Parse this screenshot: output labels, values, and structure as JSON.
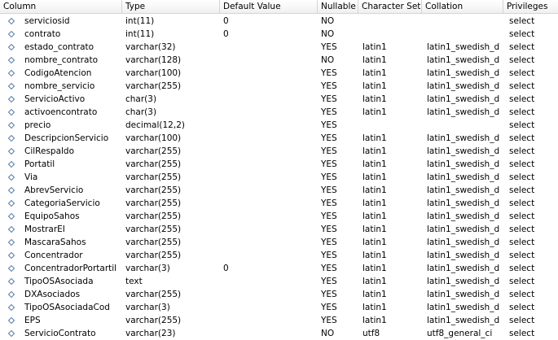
{
  "headers": [
    "Column",
    "Type",
    "Default Value",
    "Nullable",
    "Character Set",
    "Collation",
    "Privileges"
  ],
  "column_icon": "diamond-column-icon",
  "rows": [
    [
      "serviciosid",
      "int(11)",
      "0",
      "NO",
      "",
      "",
      "select"
    ],
    [
      "contrato",
      "int(11)",
      "0",
      "NO",
      "",
      "",
      "select"
    ],
    [
      "estado_contrato",
      "varchar(32)",
      "",
      "YES",
      "latin1",
      "latin1_swedish_d",
      "select"
    ],
    [
      "nombre_contrato",
      "varchar(128)",
      "",
      "NO",
      "latin1",
      "latin1_swedish_d",
      "select"
    ],
    [
      "CodigoAtencion",
      "varchar(100)",
      "",
      "YES",
      "latin1",
      "latin1_swedish_d",
      "select"
    ],
    [
      "nombre_servicio",
      "varchar(255)",
      "",
      "YES",
      "latin1",
      "latin1_swedish_d",
      "select"
    ],
    [
      "ServicioActivo",
      "char(3)",
      "",
      "YES",
      "latin1",
      "latin1_swedish_d",
      "select"
    ],
    [
      "activoencontrato",
      "char(3)",
      "",
      "YES",
      "latin1",
      "latin1_swedish_d",
      "select"
    ],
    [
      "precio",
      "decimal(12,2)",
      "",
      "YES",
      "",
      "",
      "select"
    ],
    [
      "DescripcionServicio",
      "varchar(100)",
      "",
      "YES",
      "latin1",
      "latin1_swedish_d",
      "select"
    ],
    [
      "CilRespaldo",
      "varchar(255)",
      "",
      "YES",
      "latin1",
      "latin1_swedish_d",
      "select"
    ],
    [
      "Portatil",
      "varchar(255)",
      "",
      "YES",
      "latin1",
      "latin1_swedish_d",
      "select"
    ],
    [
      "Via",
      "varchar(255)",
      "",
      "YES",
      "latin1",
      "latin1_swedish_d",
      "select"
    ],
    [
      "AbrevServicio",
      "varchar(255)",
      "",
      "YES",
      "latin1",
      "latin1_swedish_d",
      "select"
    ],
    [
      "CategoriaServicio",
      "varchar(255)",
      "",
      "YES",
      "latin1",
      "latin1_swedish_d",
      "select"
    ],
    [
      "EquipoSahos",
      "varchar(255)",
      "",
      "YES",
      "latin1",
      "latin1_swedish_d",
      "select"
    ],
    [
      "MostrarEI",
      "varchar(255)",
      "",
      "YES",
      "latin1",
      "latin1_swedish_d",
      "select"
    ],
    [
      "MascaraSahos",
      "varchar(255)",
      "",
      "YES",
      "latin1",
      "latin1_swedish_d",
      "select"
    ],
    [
      "Concentrador",
      "varchar(255)",
      "",
      "YES",
      "latin1",
      "latin1_swedish_d",
      "select"
    ],
    [
      "ConcentradorPortartil",
      "varchar(3)",
      "0",
      "YES",
      "latin1",
      "latin1_swedish_d",
      "select"
    ],
    [
      "TipoOSAsociada",
      "text",
      "",
      "YES",
      "latin1",
      "latin1_swedish_d",
      "select"
    ],
    [
      "DXAsociados",
      "varchar(255)",
      "",
      "YES",
      "latin1",
      "latin1_swedish_d",
      "select"
    ],
    [
      "TipoOSAsociadaCod",
      "varchar(3)",
      "",
      "YES",
      "latin1",
      "latin1_swedish_d",
      "select"
    ],
    [
      "EPS",
      "varchar(255)",
      "",
      "YES",
      "latin1",
      "latin1_swedish_d",
      "select"
    ],
    [
      "ServicioContrato",
      "varchar(23)",
      "",
      "NO",
      "utf8",
      "utf8_general_ci",
      "select"
    ]
  ]
}
